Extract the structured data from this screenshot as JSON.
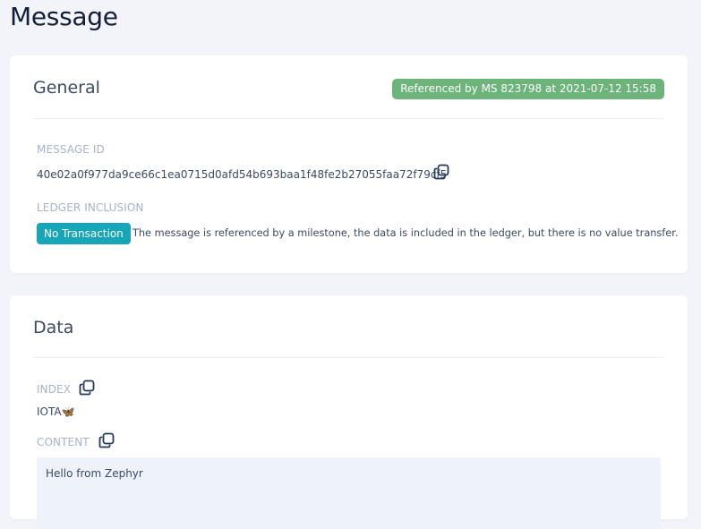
{
  "page": {
    "title": "Message"
  },
  "general": {
    "title": "General",
    "milestone_badge": "Referenced by MS 823798 at 2021-07-12 15:58",
    "message_id_label": "MESSAGE ID",
    "message_id": "40e02a0f977da9ce66c1ea0715d0afd54b693baa1f48fe2b27055faa72f79cf5",
    "ledger_inclusion_label": "LEDGER INCLUSION",
    "ledger_badge": "No Transaction",
    "ledger_description": "The message is referenced by a milestone, the data is included in the ledger, but there is no value transfer."
  },
  "data": {
    "title": "Data",
    "index_label": "INDEX",
    "index_value": "IOTA🦋",
    "content_label": "CONTENT",
    "content_value": "Hello from Zephyr"
  },
  "colors": {
    "milestone_badge": "#6cb47a",
    "ledger_badge": "#16a6b8",
    "label": "#a7b3cc",
    "content_background": "#eef3fb"
  },
  "icons": {
    "copy": "copy-icon"
  }
}
